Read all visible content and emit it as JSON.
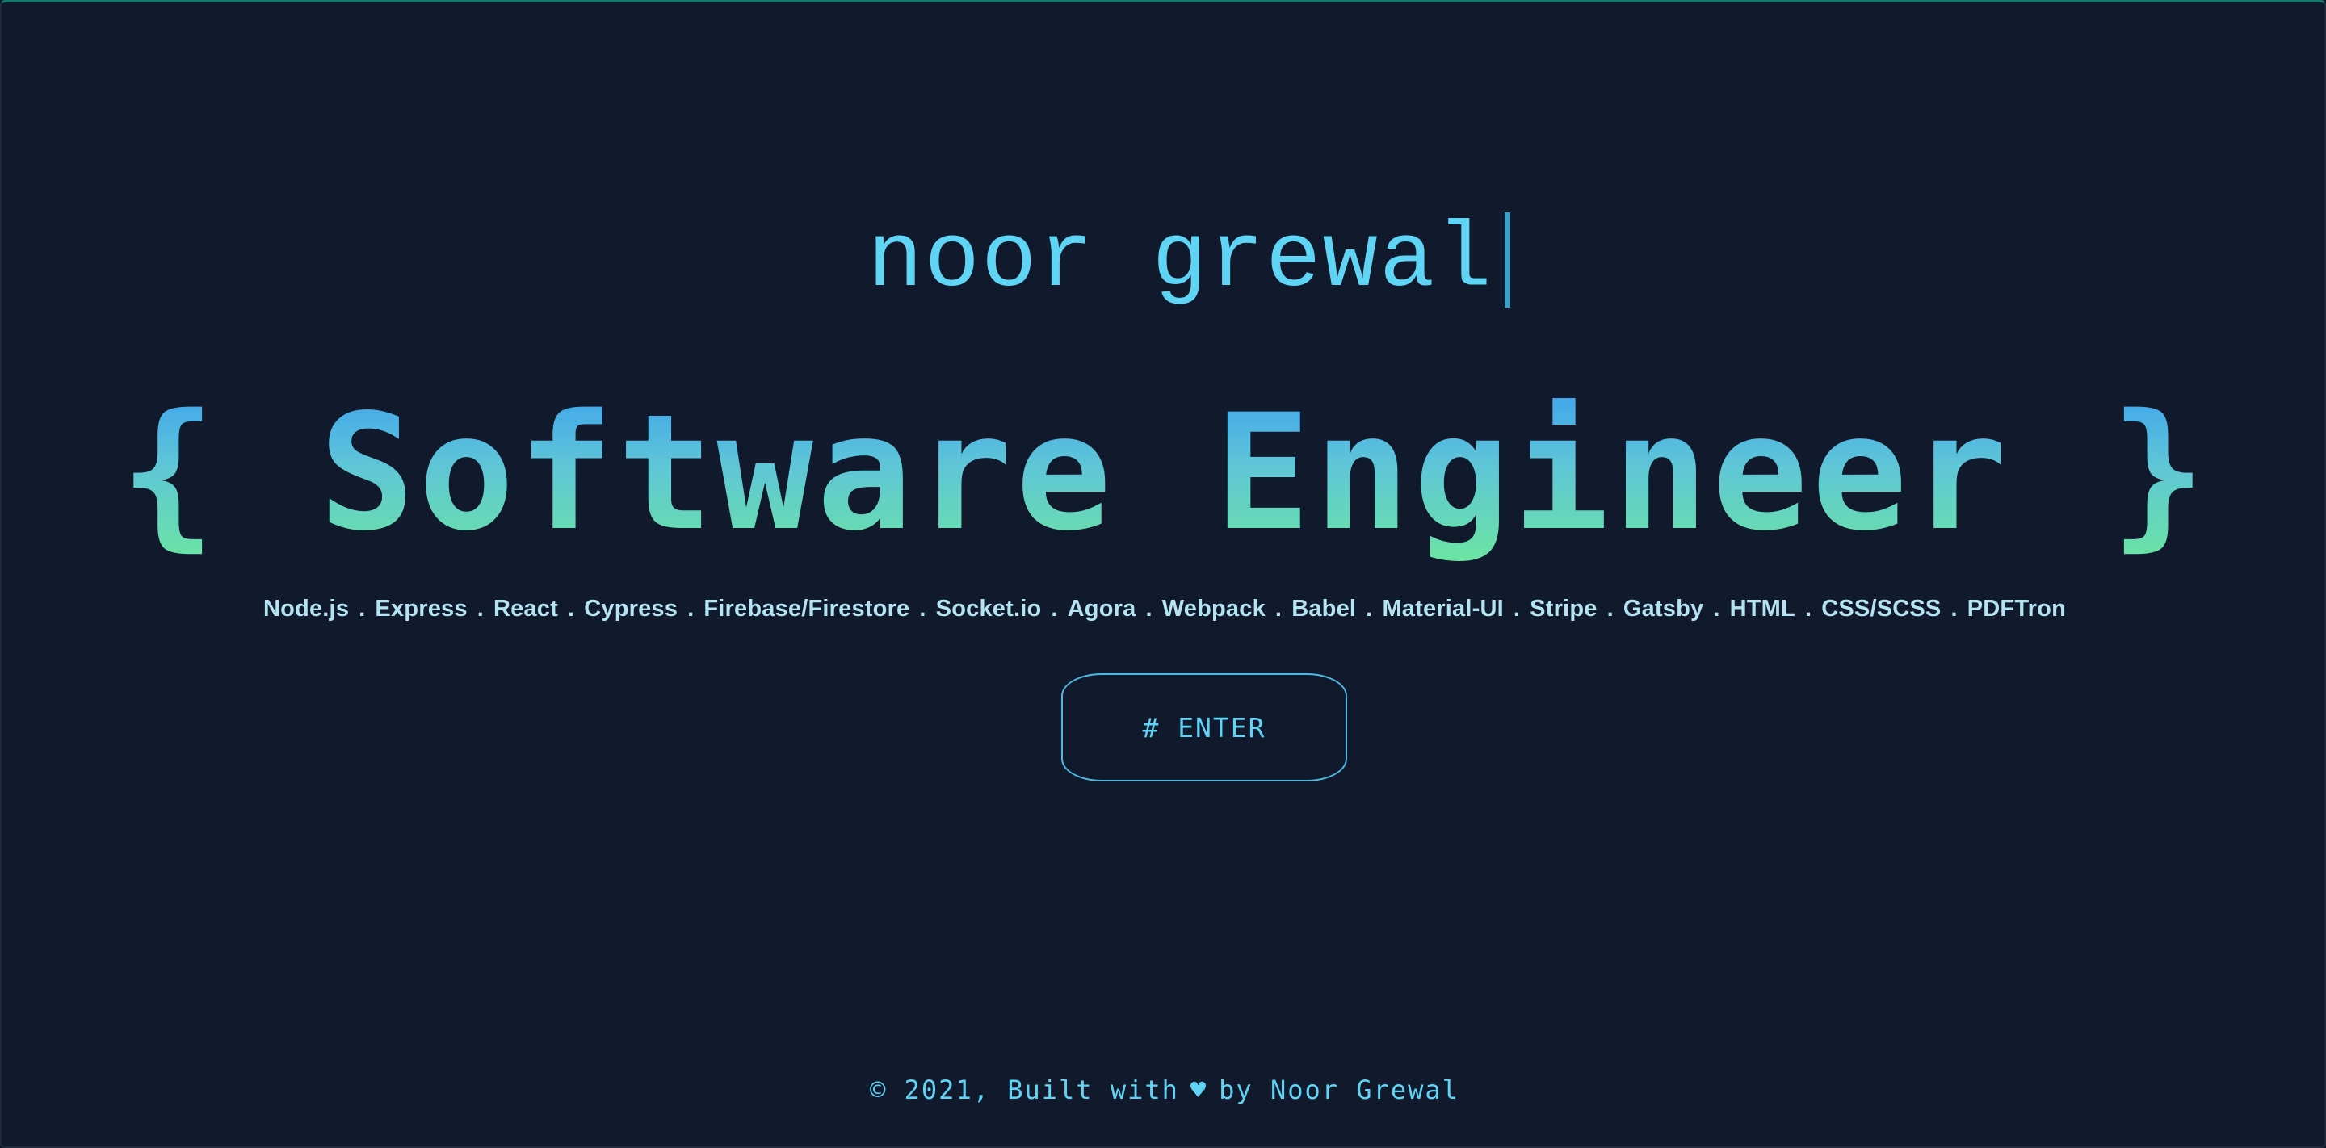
{
  "hero": {
    "name": "noor grewal",
    "title_open": "{",
    "title": "Software Engineer",
    "title_close": "}"
  },
  "skills": [
    "Node.js",
    "Express",
    "React",
    "Cypress",
    "Firebase/Firestore",
    "Socket.io",
    "Agora",
    "Webpack",
    "Babel",
    "Material-UI",
    "Stripe",
    "Gatsby",
    "HTML",
    "CSS/SCSS",
    "PDFTron"
  ],
  "skills_separator": ".",
  "enter_button": {
    "label": "# ENTER"
  },
  "footer": {
    "prefix": "© 2021, Built with",
    "heart_icon": "heart-icon",
    "heart_glyph": "♥",
    "suffix": "by Noor Grewal"
  },
  "colors": {
    "background": "#111a2c",
    "accent": "#60d4f5",
    "gradient_top": "#3a9ff0",
    "gradient_bottom": "#6ce6a0",
    "skills_text": "#b4e4f2"
  }
}
